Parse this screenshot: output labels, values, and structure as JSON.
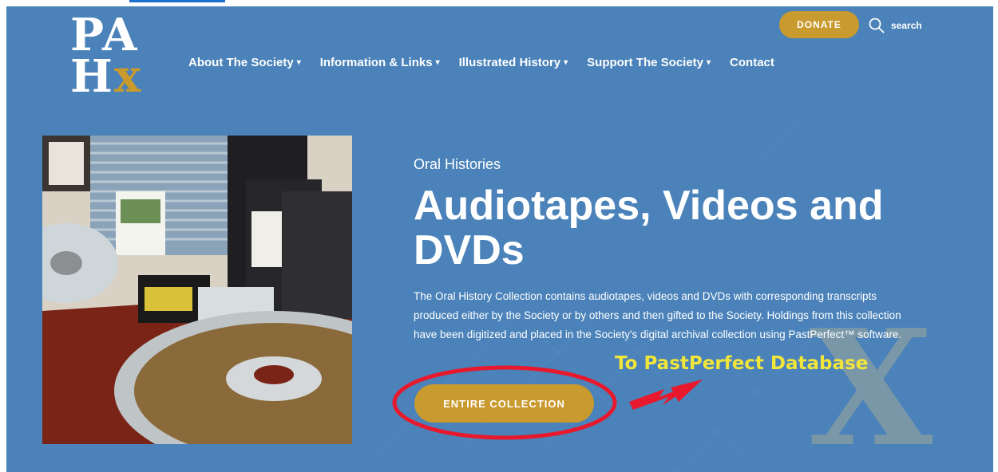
{
  "logo": {
    "line1": "PA",
    "line2_h": "H",
    "line2_x": "x"
  },
  "nav": {
    "items": [
      {
        "label": "About The Society",
        "caret": "▾"
      },
      {
        "label": "Information & Links",
        "caret": "▾"
      },
      {
        "label": "Illustrated History",
        "caret": "▾"
      },
      {
        "label": "Support The Society",
        "caret": "▾"
      },
      {
        "label": "Contact",
        "caret": ""
      }
    ]
  },
  "header": {
    "donate_label": "DONATE",
    "search_label": "search"
  },
  "hero": {
    "eyebrow": "Oral Histories",
    "title": "Audiotapes, Videos and DVDs",
    "description": "The Oral History Collection contains audiotapes, videos and DVDs with corresponding transcripts produced either by the Society or by others and then gifted to the Society. Holdings from this collection have been digitized and placed in the Society's digital archival collection using PastPerfect™ software.",
    "button_label": "ENTIRE COLLECTION",
    "annotation": "To PastPerfect Database",
    "watermark": "X"
  },
  "colors": {
    "accent": "#c99a2e",
    "background": "#4a82b9",
    "annotation": "#f2e63b",
    "circle": "#e8192c"
  }
}
